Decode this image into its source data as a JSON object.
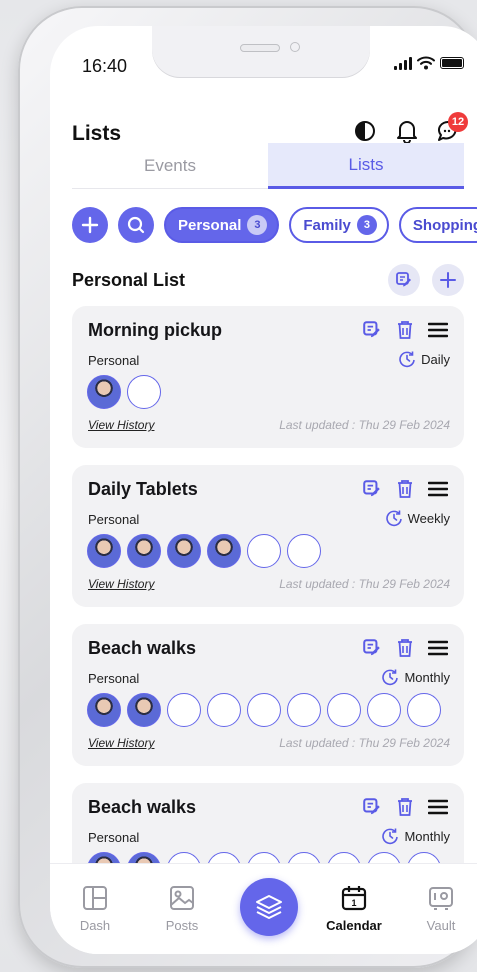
{
  "status": {
    "time": "16:40"
  },
  "header": {
    "title": "Lists",
    "notification_badge": "12"
  },
  "tabs": [
    {
      "label": "Events",
      "active": false
    },
    {
      "label": "Lists",
      "active": true
    }
  ],
  "filters": [
    {
      "label": "Personal",
      "count": "3",
      "active": true
    },
    {
      "label": "Family",
      "count": "3",
      "active": false
    },
    {
      "label": "Shopping",
      "count": "",
      "active": false
    }
  ],
  "section": {
    "title": "Personal List"
  },
  "cards": [
    {
      "title": "Morning pickup",
      "category": "Personal",
      "frequency": "Daily",
      "filled_avatars": 1,
      "total_avatars": 2,
      "link": "View History",
      "updated": "Last updated : Thu 29 Feb 2024"
    },
    {
      "title": "Daily Tablets",
      "category": "Personal",
      "frequency": "Weekly",
      "filled_avatars": 4,
      "total_avatars": 6,
      "link": "View History",
      "updated": "Last updated : Thu 29 Feb 2024"
    },
    {
      "title": "Beach walks",
      "category": "Personal",
      "frequency": "Monthly",
      "filled_avatars": 2,
      "total_avatars": 9,
      "link": "View History",
      "updated": "Last updated : Thu 29 Feb 2024"
    },
    {
      "title": "Beach walks",
      "category": "Personal",
      "frequency": "Monthly",
      "filled_avatars": 2,
      "total_avatars": 9,
      "link": "",
      "updated": ""
    }
  ],
  "nav": [
    {
      "label": "Dash",
      "icon": "dashboard-icon",
      "active": false
    },
    {
      "label": "Posts",
      "icon": "image-icon",
      "active": false
    },
    {
      "label": "",
      "icon": "layers-icon",
      "active": false
    },
    {
      "label": "Calendar",
      "icon": "calendar-icon",
      "active": true
    },
    {
      "label": "Vault",
      "icon": "vault-icon",
      "active": false
    }
  ],
  "colors": {
    "accent": "#6466ea",
    "tab_active_bg": "#e6e9fb",
    "card_bg": "#f2f2f4",
    "badge": "#ef3b3b"
  }
}
